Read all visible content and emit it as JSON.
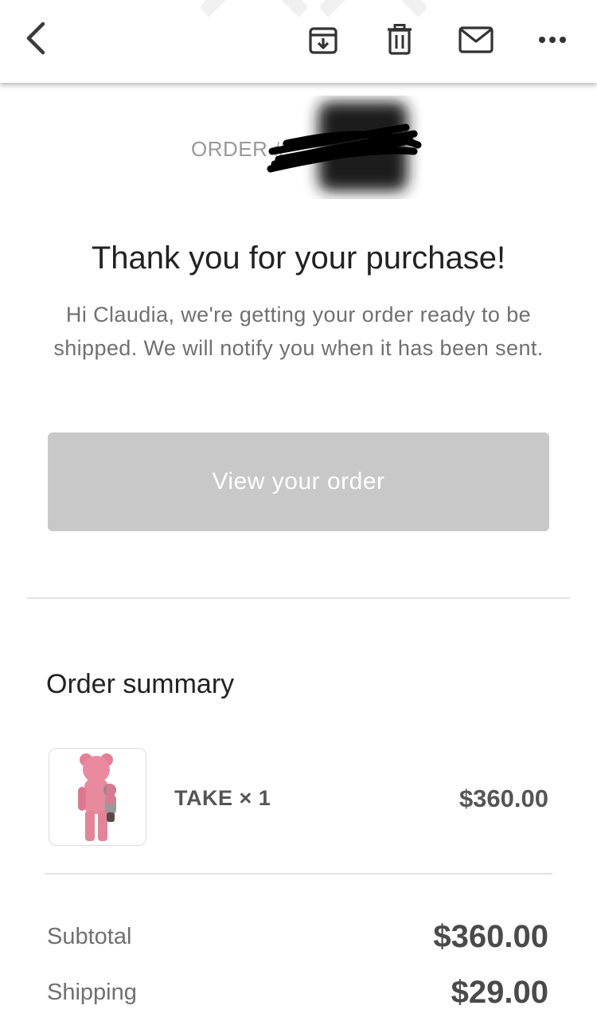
{
  "toolbar": {
    "back_icon": "chevron-left-icon",
    "archive_icon": "archive-icon",
    "delete_icon": "trash-icon",
    "mail_icon": "mail-icon",
    "more_icon": "more-horizontal-icon"
  },
  "order": {
    "number_prefix": "ORDER #"
  },
  "confirmation": {
    "title": "Thank you for your purchase!",
    "message": "Hi Claudia, we're getting your order ready to be shipped. We will notify you when it has been sent.",
    "button_label": "View your order"
  },
  "summary": {
    "title": "Order summary",
    "items": [
      {
        "name": "TAKE × 1",
        "price": "$360.00"
      }
    ],
    "subtotal_label": "Subtotal",
    "subtotal_value": "$360.00",
    "shipping_label": "Shipping",
    "shipping_value": "$29.00"
  },
  "colors": {
    "button_bg": "#c8c8c8",
    "product_pink": "#e9899e"
  }
}
